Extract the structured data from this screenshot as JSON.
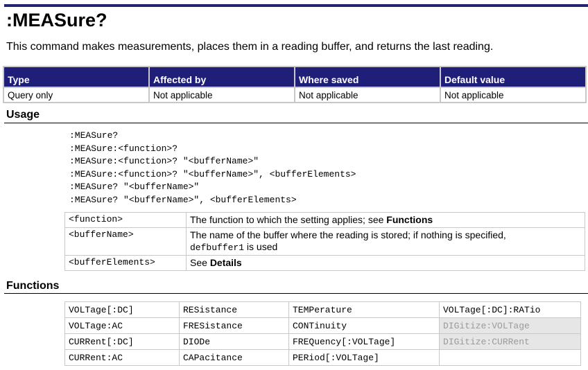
{
  "title": ":MEASure?",
  "description": "This command makes measurements, places them in a reading buffer, and returns the last reading.",
  "properties": {
    "headers": [
      "Type",
      "Affected by",
      "Where saved",
      "Default value"
    ],
    "values": [
      "Query only",
      "Not applicable",
      "Not applicable",
      "Not applicable"
    ]
  },
  "usage": {
    "heading": "Usage",
    "lines": [
      ":MEASure?",
      ":MEASure:<function>?",
      ":MEASure:<function>? \"<bufferName>\"",
      ":MEASure:<function>? \"<bufferName>\", <bufferElements>",
      ":MEASure? \"<bufferName>\"",
      ":MEASure? \"<bufferName>\", <bufferElements>"
    ]
  },
  "parameters": [
    {
      "name": "<function>",
      "text": "The function to which the setting applies; see ",
      "bold": "Functions"
    },
    {
      "name": "<bufferName>",
      "text": "The name of the buffer where the reading is stored; if nothing is specified,",
      "code": "defbuffer1",
      "after": " is used"
    },
    {
      "name": "<bufferElements>",
      "text": "See ",
      "bold": "Details"
    }
  ],
  "functions": {
    "heading": "Functions",
    "rows": [
      [
        "VOLTage[:DC]",
        "RESistance",
        "TEMPerature",
        "VOLTage[:DC]:RATio"
      ],
      [
        "VOLTage:AC",
        "FRESistance",
        "CONTinuity",
        "DIGitize:VOLTage"
      ],
      [
        "CURRent[:DC]",
        "DIODe",
        "FREQuency[:VOLTage]",
        "DIGitize:CURRent"
      ],
      [
        "CURRent:AC",
        "CAPacitance",
        "PERiod[:VOLTage]",
        ""
      ]
    ],
    "dimmed": [
      "DIGitize:VOLTage",
      "DIGitize:CURRent"
    ]
  }
}
